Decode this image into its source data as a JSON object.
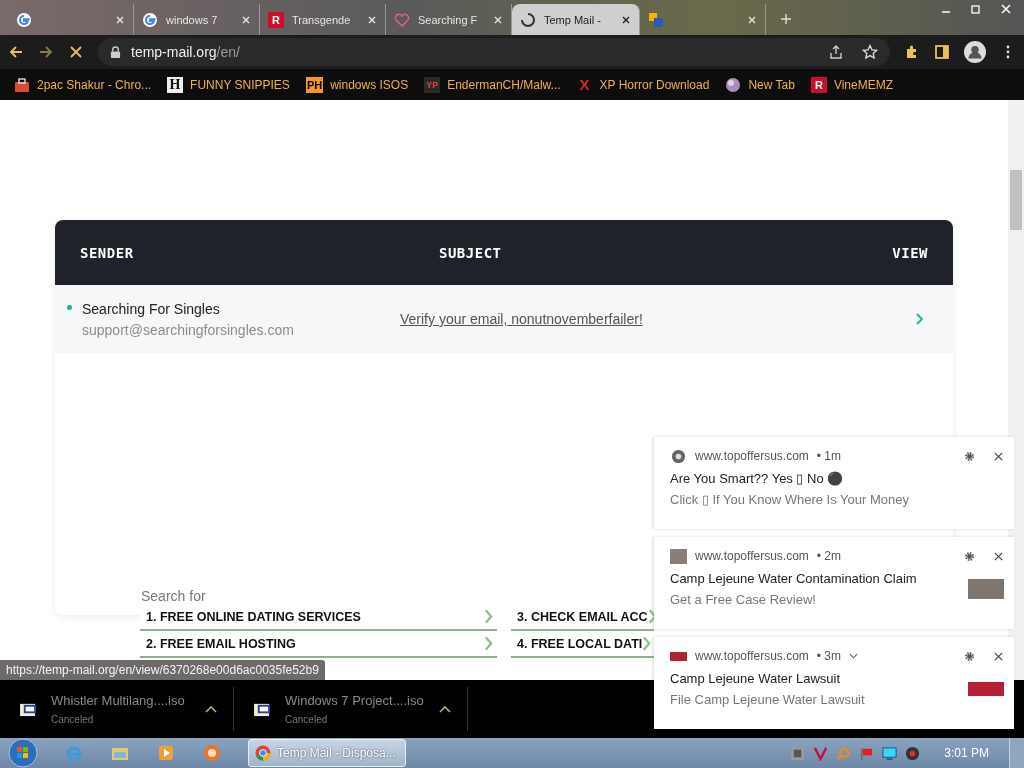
{
  "browser": {
    "tabs": [
      {
        "kind": "google",
        "selected": false
      },
      {
        "kind": "google",
        "title": "windows 7",
        "selected": false
      },
      {
        "kind": "letter",
        "badge": "R",
        "title": "Transgende",
        "selected": false
      },
      {
        "kind": "heart",
        "title": "Searching F",
        "selected": false
      },
      {
        "kind": "spinner",
        "title": "Temp Mail -",
        "selected": true
      },
      {
        "kind": "office",
        "selected": false
      }
    ],
    "address": {
      "host": "temp-mail.org",
      "path": "/en/",
      "loading": true
    },
    "bookmarks": [
      {
        "kind": "bag",
        "label": "2pac Shakur - Chro..."
      },
      {
        "kind": "plain",
        "badge": "H",
        "label": "FUNNY SNIPPIES"
      },
      {
        "kind": "orange",
        "badge": "PH",
        "label": "windows ISOS"
      },
      {
        "kind": "dark",
        "badge": "YP",
        "label": "EndermanCH/Malw..."
      },
      {
        "kind": "x",
        "badge": "X",
        "label": "XP Horror Download"
      },
      {
        "kind": "globe",
        "label": "New Tab"
      },
      {
        "kind": "red",
        "badge": "R",
        "label": "VineMEMZ"
      }
    ]
  },
  "mail": {
    "columns": [
      "SENDER",
      "SUBJECT",
      "VIEW"
    ],
    "messages": [
      {
        "sender": "Searching For Singles",
        "address": "support@searchingforsingles.com",
        "subject": "Verify your email, nonutnovemberfailer!",
        "unread": true
      }
    ]
  },
  "ads": {
    "title": "Search for",
    "items": [
      {
        "number": "1.",
        "text": "FREE ONLINE DATING SERVICES"
      },
      {
        "number": "3.",
        "text": "CHECK EMAIL ACC"
      },
      {
        "number": "2.",
        "text": "FREE EMAIL HOSTING"
      },
      {
        "number": "4.",
        "text": "FREE LOCAL DATI"
      }
    ]
  },
  "notifications": [
    {
      "kind": "plain",
      "site": "www.topoffersus.com",
      "age": "• 1m",
      "expandable": false,
      "title": "Are You Smart?? Yes ▯ No ⚫",
      "body": "Click ▯ If You Know Where Is Your Money"
    },
    {
      "kind": "photo",
      "site": "www.topoffersus.com",
      "age": "• 2m",
      "expandable": false,
      "title": "Camp Lejeune Water Contamination Claim",
      "body": "Get a Free Case Review!"
    },
    {
      "kind": "banner",
      "site": "www.topoffersus.com",
      "age": "• 3m",
      "expandable": true,
      "title": "Camp Lejeune Water Lawsuit",
      "body": "File Camp Lejeune Water Lawsuit"
    }
  ],
  "status_url": "https://temp-mail.org/en/view/6370268e00d6ac0035fe52b9",
  "downloads": [
    {
      "name": "Whistler Multilang....iso",
      "status": "Canceled"
    },
    {
      "name": "Windows 7 Project....iso",
      "status": "Canceled"
    }
  ],
  "taskbar": {
    "window": "Temp Mail - Disposa...",
    "clock": "3:01 PM"
  }
}
